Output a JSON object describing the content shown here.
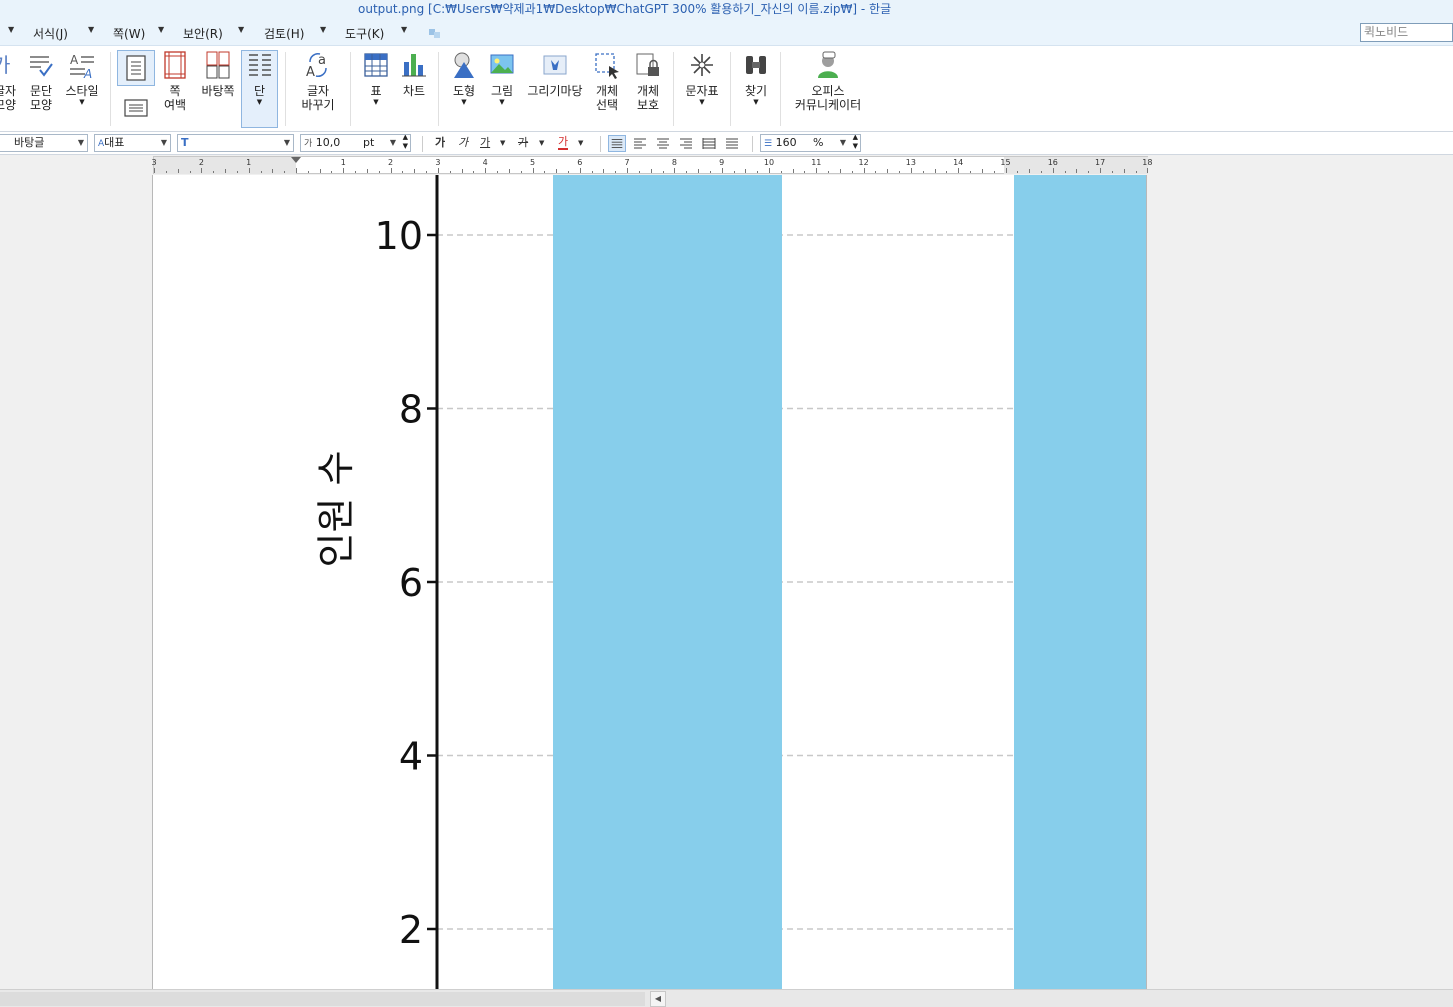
{
  "window": {
    "title": "output.png [C:₩Users₩약제과1₩Desktop₩ChatGPT 300% 활용하기_자신의 이름.zip₩] - 한글"
  },
  "menubar": {
    "items": [
      {
        "label": "서식(J)"
      },
      {
        "label": "쪽(W)"
      },
      {
        "label": "보안(R)"
      },
      {
        "label": "검토(H)"
      },
      {
        "label": "도구(K)"
      }
    ],
    "quick_input_placeholder": "퀵노비드"
  },
  "ribbon": {
    "items": [
      {
        "label": "글자\n모양"
      },
      {
        "label": "문단\n모양"
      },
      {
        "label": "스타일"
      },
      {
        "label": "쪽\n여백"
      },
      {
        "label": "바탕쪽"
      },
      {
        "label": "단"
      },
      {
        "label": "글자\n바꾸기"
      },
      {
        "label": "표"
      },
      {
        "label": "차트"
      },
      {
        "label": "도형"
      },
      {
        "label": "그림"
      },
      {
        "label": "그리기마당"
      },
      {
        "label": "개체\n선택"
      },
      {
        "label": "개체\n보호"
      },
      {
        "label": "문자표"
      },
      {
        "label": "찾기"
      },
      {
        "label": "오피스\n커뮤니케이터"
      }
    ]
  },
  "fmtbar": {
    "style": "바탕글",
    "lang": "대표",
    "font": "",
    "font_size": "10,0",
    "unit": "pt",
    "bold": "가",
    "italic": "가",
    "underline": "가",
    "strike": "가",
    "color": "가",
    "line_spacing": "160",
    "line_spacing_unit": "%"
  },
  "ruler": {
    "labels": [
      "3",
      "2",
      "1",
      "1",
      "2",
      "3",
      "4",
      "5",
      "6",
      "7",
      "8",
      "9",
      "10",
      "11",
      "12",
      "13",
      "14",
      "15",
      "16",
      "17",
      "18"
    ]
  },
  "chart_data": {
    "type": "bar",
    "ylabel": "인원 수",
    "yticks": [
      "10",
      "8",
      "6",
      "4",
      "2"
    ],
    "ylim_visible": [
      1.2,
      10.7
    ],
    "bar_color": "#87ceeb",
    "grid": true,
    "bars_visible": [
      {
        "value_exceeds_view": true
      },
      {
        "value_exceeds_view": true
      }
    ]
  }
}
